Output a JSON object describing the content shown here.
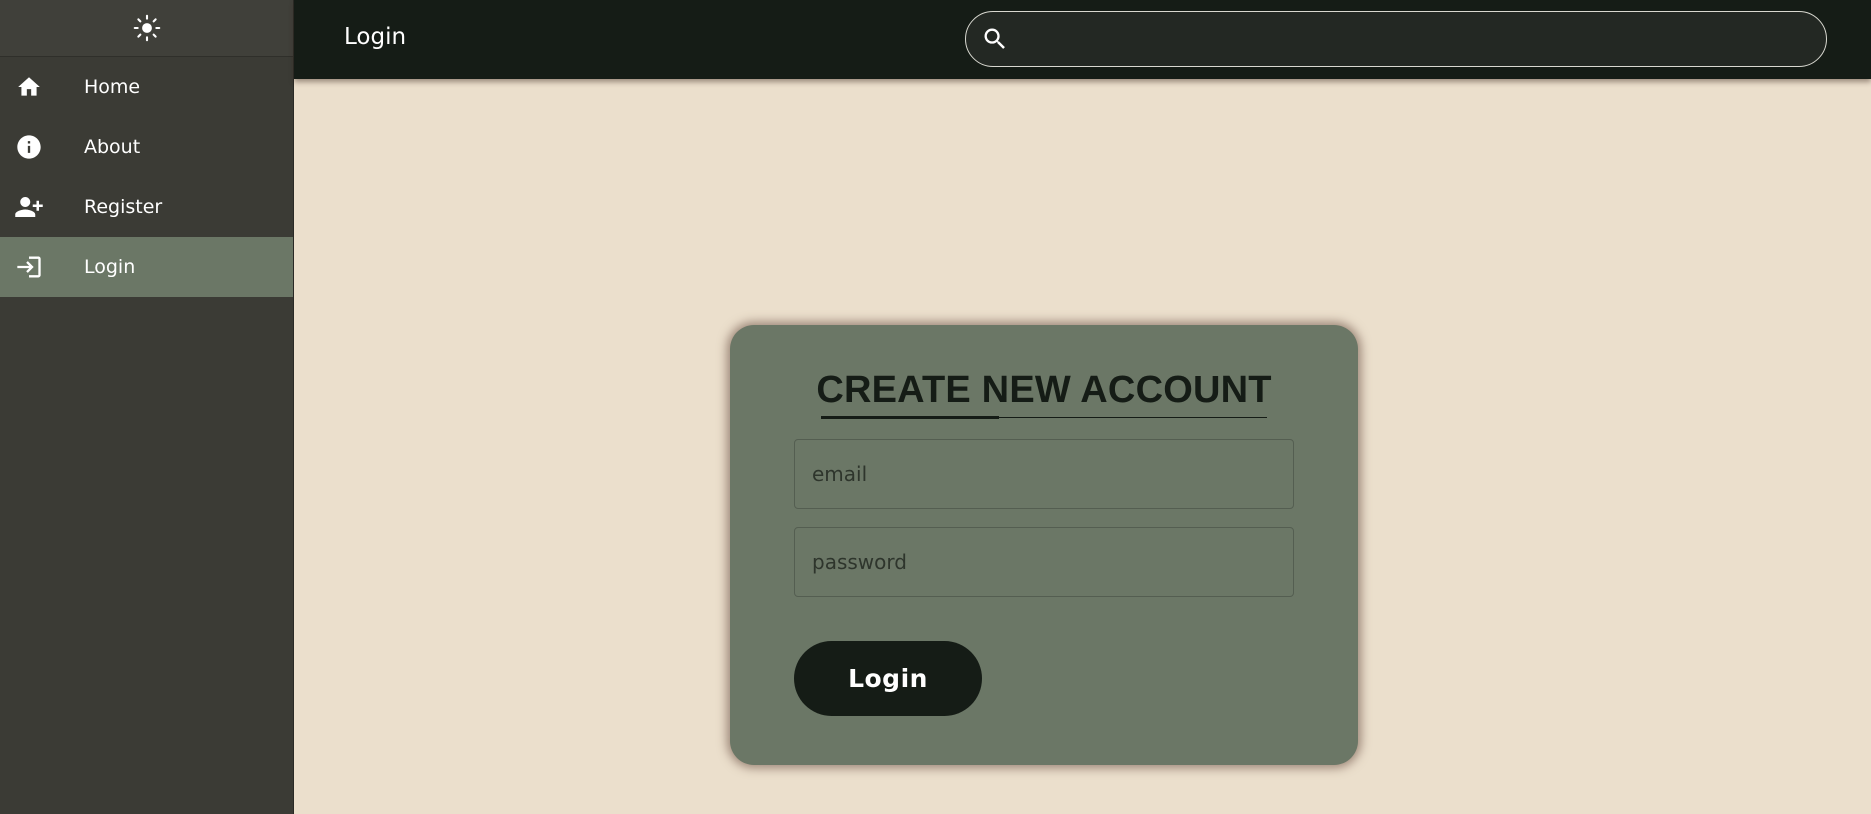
{
  "sidebar": {
    "theme_toggle_icon": "sun-icon",
    "items": [
      {
        "label": "Home",
        "icon": "home-icon",
        "active": false
      },
      {
        "label": "About",
        "icon": "info-icon",
        "active": false
      },
      {
        "label": "Register",
        "icon": "person-add-icon",
        "active": false
      },
      {
        "label": "Login",
        "icon": "login-icon",
        "active": true
      }
    ]
  },
  "header": {
    "title": "Login",
    "search": {
      "placeholder": "",
      "value": ""
    }
  },
  "form": {
    "title": "CREATE NEW ACCOUNT",
    "email_placeholder": "email",
    "password_placeholder": "password",
    "submit_label": "Login"
  },
  "colors": {
    "page_background": "#ebdfcc",
    "sidebar_background": "#3b3b35",
    "active_item": "#6b7766",
    "topbar": "#151c16",
    "card": "#6b7766",
    "button": "#151c16"
  }
}
